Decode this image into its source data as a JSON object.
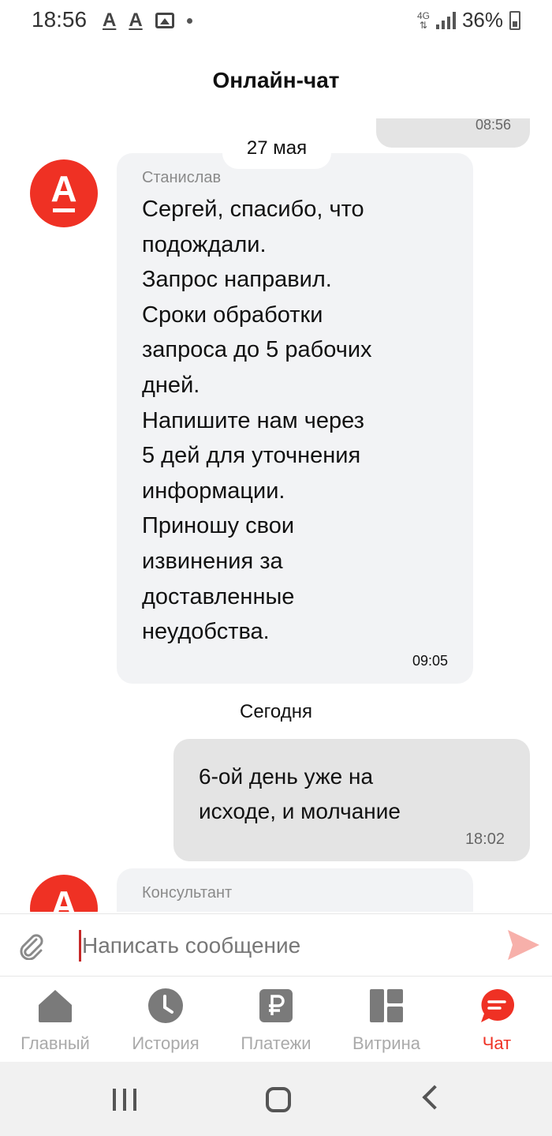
{
  "status_bar": {
    "time": "18:56",
    "notif_a1": "A",
    "notif_a2": "A",
    "network": "4G",
    "battery": "36%"
  },
  "header": {
    "title": "Онлайн-чат"
  },
  "chat": {
    "prev_outgoing_time": "08:56",
    "date_separator": "27 мая",
    "message_1": {
      "sender": "Станислав",
      "lines": [
        "Сергей, спасибо, что",
        "подождали.",
        "Запрос направил.",
        "Сроки обработки",
        "запроса до 5 рабочих",
        "дней.",
        "Напишите нам через",
        "5 дей для уточнения",
        "информации.",
        "Приношу свои",
        "извинения за",
        "доставленные",
        "неудобства."
      ],
      "time": "09:05"
    },
    "today_label": "Сегодня",
    "message_2": {
      "lines": [
        "6-ой день уже на",
        "исходе, и молчание"
      ],
      "time": "18:02"
    },
    "message_3": {
      "sender": "Консультант"
    }
  },
  "input": {
    "placeholder": "Написать сообщение"
  },
  "tabs": [
    {
      "label": "Главный",
      "icon": "home-icon",
      "active": false
    },
    {
      "label": "История",
      "icon": "clock-icon",
      "active": false
    },
    {
      "label": "Платежи",
      "icon": "ruble-icon",
      "active": false
    },
    {
      "label": "Витрина",
      "icon": "grid-icon",
      "active": false
    },
    {
      "label": "Чат",
      "icon": "chat-icon",
      "active": true
    }
  ],
  "colors": {
    "brand_red": "#ef3124",
    "incoming_bubble": "#f2f3f5",
    "outgoing_bubble": "#e4e4e4",
    "tab_inactive": "#aaaaaa"
  }
}
